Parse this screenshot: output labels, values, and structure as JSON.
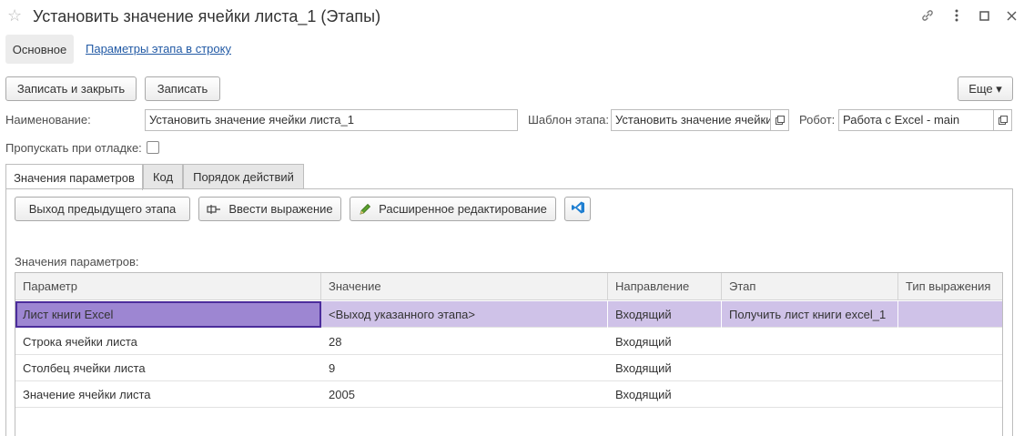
{
  "window": {
    "title": "Установить значение ячейки листа_1 (Этапы)",
    "star_icon": "☆",
    "link_icon": "⛓",
    "menu_icon": "⋮",
    "maximize_icon": "☐",
    "close_icon": "✕"
  },
  "top_tabs": {
    "main": "Основное",
    "params_link": "Параметры этапа в строку"
  },
  "toolbar": {
    "save_close": "Записать и закрыть",
    "save": "Записать",
    "more": "Еще ▾"
  },
  "form": {
    "name_label": "Наименование:",
    "name_value": "Установить значение ячейки листа_1",
    "template_label": "Шаблон этапа:",
    "template_value": "Установить значение ячейки",
    "robot_label": "Робот:",
    "robot_value": "Работа с Excel - main",
    "skip_label": "Пропускать при отладке:",
    "skip_checked": false
  },
  "inner_tabs": [
    "Значения параметров",
    "Код",
    "Порядок действий"
  ],
  "actions": {
    "prev_output": "Выход предыдущего этапа",
    "enter_expr": "Ввести выражение",
    "advanced_edit": "Расширенное редактирование"
  },
  "section_label": "Значения параметров:",
  "table": {
    "columns": [
      "Параметр",
      "Значение",
      "Направление",
      "Этап",
      "Тип выражения"
    ],
    "rows": [
      [
        "Лист книги Excel",
        "<Выход указанного этапа>",
        "Входящий",
        "Получить лист книги excel_1",
        ""
      ],
      [
        "Строка ячейки листа",
        "28",
        "Входящий",
        "",
        ""
      ],
      [
        "Столбец ячейки листа",
        "9",
        "Входящий",
        "",
        ""
      ],
      [
        "Значение ячейки листа",
        "2005",
        "Входящий",
        "",
        ""
      ]
    ]
  },
  "colors": {
    "selected_row": "#cfc2e8",
    "focused_cell": "#9d86d2",
    "link": "#225aa5",
    "vscode_icon": "#1f7fd1"
  }
}
